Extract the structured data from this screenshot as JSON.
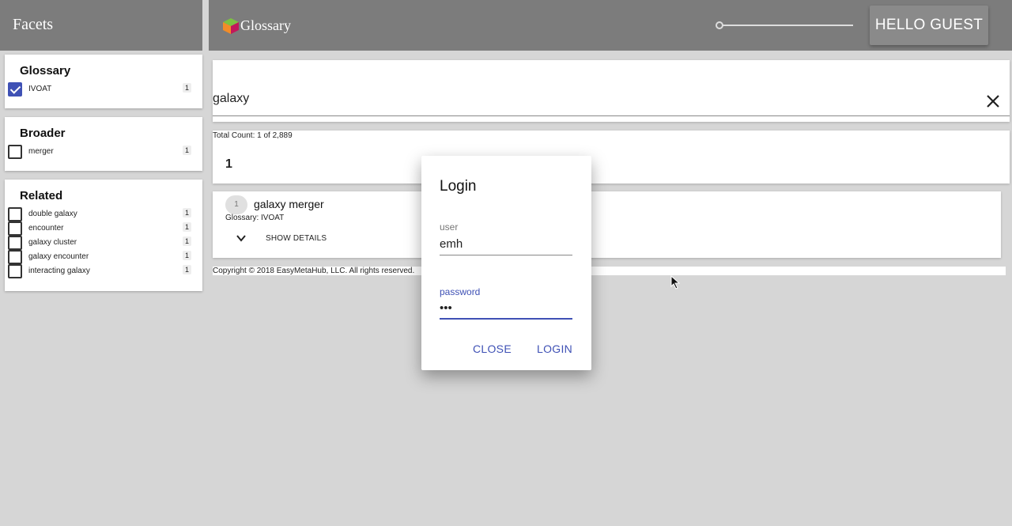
{
  "sidebar": {
    "title": "Facets",
    "glossary": {
      "title": "Glossary",
      "items": [
        {
          "label": "IVOAT",
          "count": "1",
          "checked": true
        }
      ]
    },
    "broader": {
      "title": "Broader",
      "items": [
        {
          "label": "merger",
          "count": "1",
          "checked": false
        }
      ]
    },
    "related": {
      "title": "Related",
      "items": [
        {
          "label": "double galaxy",
          "count": "1",
          "checked": false
        },
        {
          "label": "encounter",
          "count": "1",
          "checked": false
        },
        {
          "label": "galaxy cluster",
          "count": "1",
          "checked": false
        },
        {
          "label": "galaxy encounter",
          "count": "1",
          "checked": false
        },
        {
          "label": "interacting galaxy",
          "count": "1",
          "checked": false
        }
      ]
    }
  },
  "header": {
    "app_title": "Glossary",
    "user_button": "HELLO GUEST"
  },
  "search": {
    "value": "galaxy"
  },
  "results": {
    "total_count": "Total Count: 1 of 2,889",
    "page": "1",
    "items": [
      {
        "index": "1",
        "title": "galaxy merger",
        "subtitle": "Glossary: IVOAT",
        "details_label": "SHOW DETAILS"
      }
    ]
  },
  "footer": {
    "copyright": "Copyright © 2018 EasyMetaHub, LLC. All rights reserved."
  },
  "login_dialog": {
    "title": "Login",
    "user_label": "user",
    "user_value": "emh",
    "password_label": "password",
    "password_value": "•••",
    "close_label": "CLOSE",
    "login_label": "LOGIN"
  },
  "colors": {
    "accent": "#3f51b5",
    "header_bg": "#7c7c7c",
    "page_bg": "#d6d6d6"
  }
}
